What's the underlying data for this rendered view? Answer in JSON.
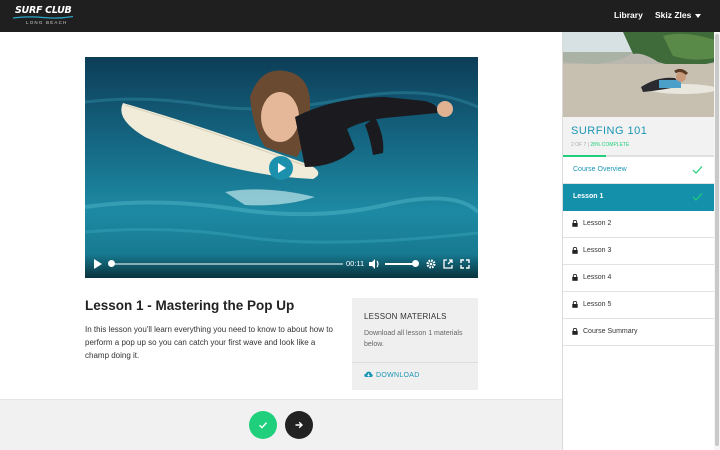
{
  "header": {
    "logo_title": "SURF CLUB",
    "logo_subtitle": "LONG BEACH",
    "nav_library": "Library",
    "user_name": "Skiz Zles"
  },
  "video": {
    "current_time": "00:11",
    "progress_fraction": 0.02,
    "volume_fraction": 0.9
  },
  "lesson": {
    "title": "Lesson 1 - Mastering the Pop Up",
    "description": "In this lesson you'll learn everything you need to know to about how to perform a pop up so you can catch your first wave and look like a champ doing it."
  },
  "materials": {
    "title": "LESSON MATERIALS",
    "text": "Download all lesson 1 materials below.",
    "download_label": "DOWNLOAD"
  },
  "course": {
    "title": "SURFING 101",
    "progress_count": "2 OF 7",
    "progress_separator": "|",
    "progress_percent": "28% COMPLETE",
    "progress_fraction": 0.28,
    "items": [
      {
        "label": "Course Overview",
        "state": "completed"
      },
      {
        "label": "Lesson 1",
        "state": "active"
      },
      {
        "label": "Lesson 2",
        "state": "locked"
      },
      {
        "label": "Lesson 3",
        "state": "locked"
      },
      {
        "label": "Lesson 4",
        "state": "locked"
      },
      {
        "label": "Lesson 5",
        "state": "locked"
      },
      {
        "label": "Course Summary",
        "state": "locked"
      }
    ]
  },
  "colors": {
    "accent_blue": "#1590ab",
    "accent_green": "#1fcf7b",
    "topbar": "#1f1f1f"
  },
  "icons": {
    "complete_button": "check-icon",
    "next_button": "arrow-right-icon",
    "locked_item": "lock-icon",
    "download": "cloud-download-icon"
  }
}
